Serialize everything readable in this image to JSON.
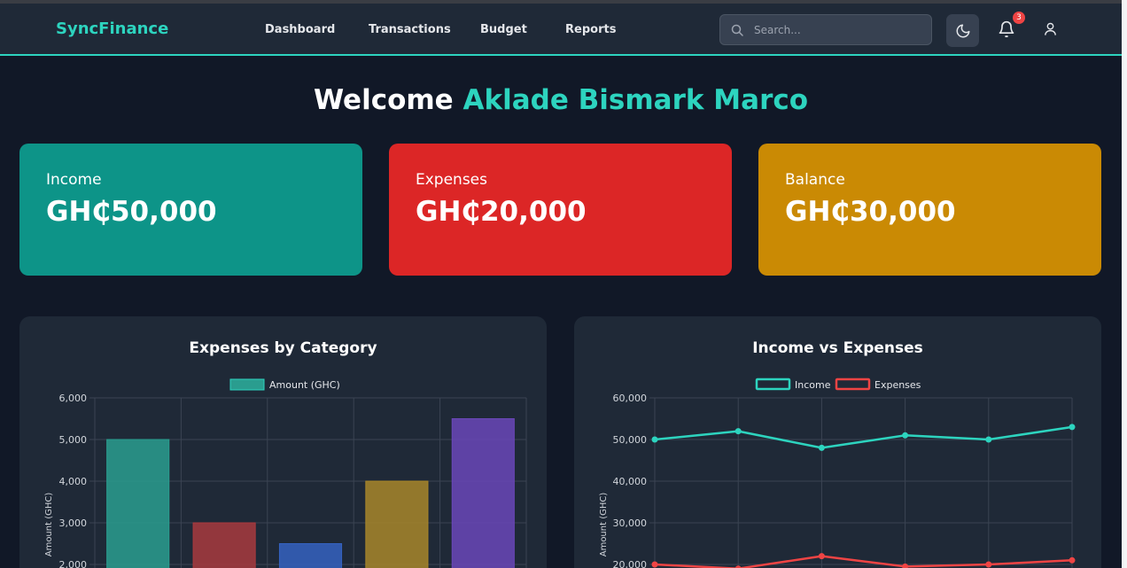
{
  "nav": {
    "brand": "SyncFinance",
    "links": [
      "Dashboard",
      "Transactions",
      "Budget",
      "Reports"
    ],
    "search_placeholder": "Search...",
    "notification_count": "3"
  },
  "welcome": {
    "prefix": "Welcome",
    "name": "Aklade Bismark Marco"
  },
  "cards": [
    {
      "label": "Income",
      "value": "GH₵50,000",
      "color": "#0d9488"
    },
    {
      "label": "Expenses",
      "value": "GH₵20,000",
      "color": "#dc2626"
    },
    {
      "label": "Balance",
      "value": "GH₵30,000",
      "color": "#ca8a04"
    }
  ],
  "chart_data": [
    {
      "type": "bar",
      "title": "Expenses by Category",
      "ylabel": "Amount (GHC)",
      "ylim": [
        2000,
        6000
      ],
      "yticks": [
        "6,000",
        "5,000",
        "4,000",
        "3,000",
        "2,000"
      ],
      "grid": true,
      "legend": "top",
      "series": [
        {
          "name": "Amount (GHC)",
          "values": [
            5000,
            3000,
            2500,
            4000,
            5500
          ],
          "colors": [
            "#2a9d8f",
            "#a83a3e",
            "#3562c0",
            "#a8862a",
            "#6a47b8"
          ]
        }
      ]
    },
    {
      "type": "line",
      "title": "Income vs Expenses",
      "ylabel": "Amount (GHC)",
      "ylim": [
        20000,
        60000
      ],
      "yticks": [
        "60,000",
        "50,000",
        "40,000",
        "30,000",
        "20,000"
      ],
      "grid": true,
      "legend": "top",
      "series": [
        {
          "name": "Income",
          "color": "#2dd4bf",
          "values": [
            50000,
            52000,
            48000,
            51000,
            50000,
            53000
          ]
        },
        {
          "name": "Expenses",
          "color": "#ef4444",
          "values": [
            20000,
            19000,
            22000,
            19500,
            20000,
            21000
          ]
        }
      ]
    }
  ]
}
